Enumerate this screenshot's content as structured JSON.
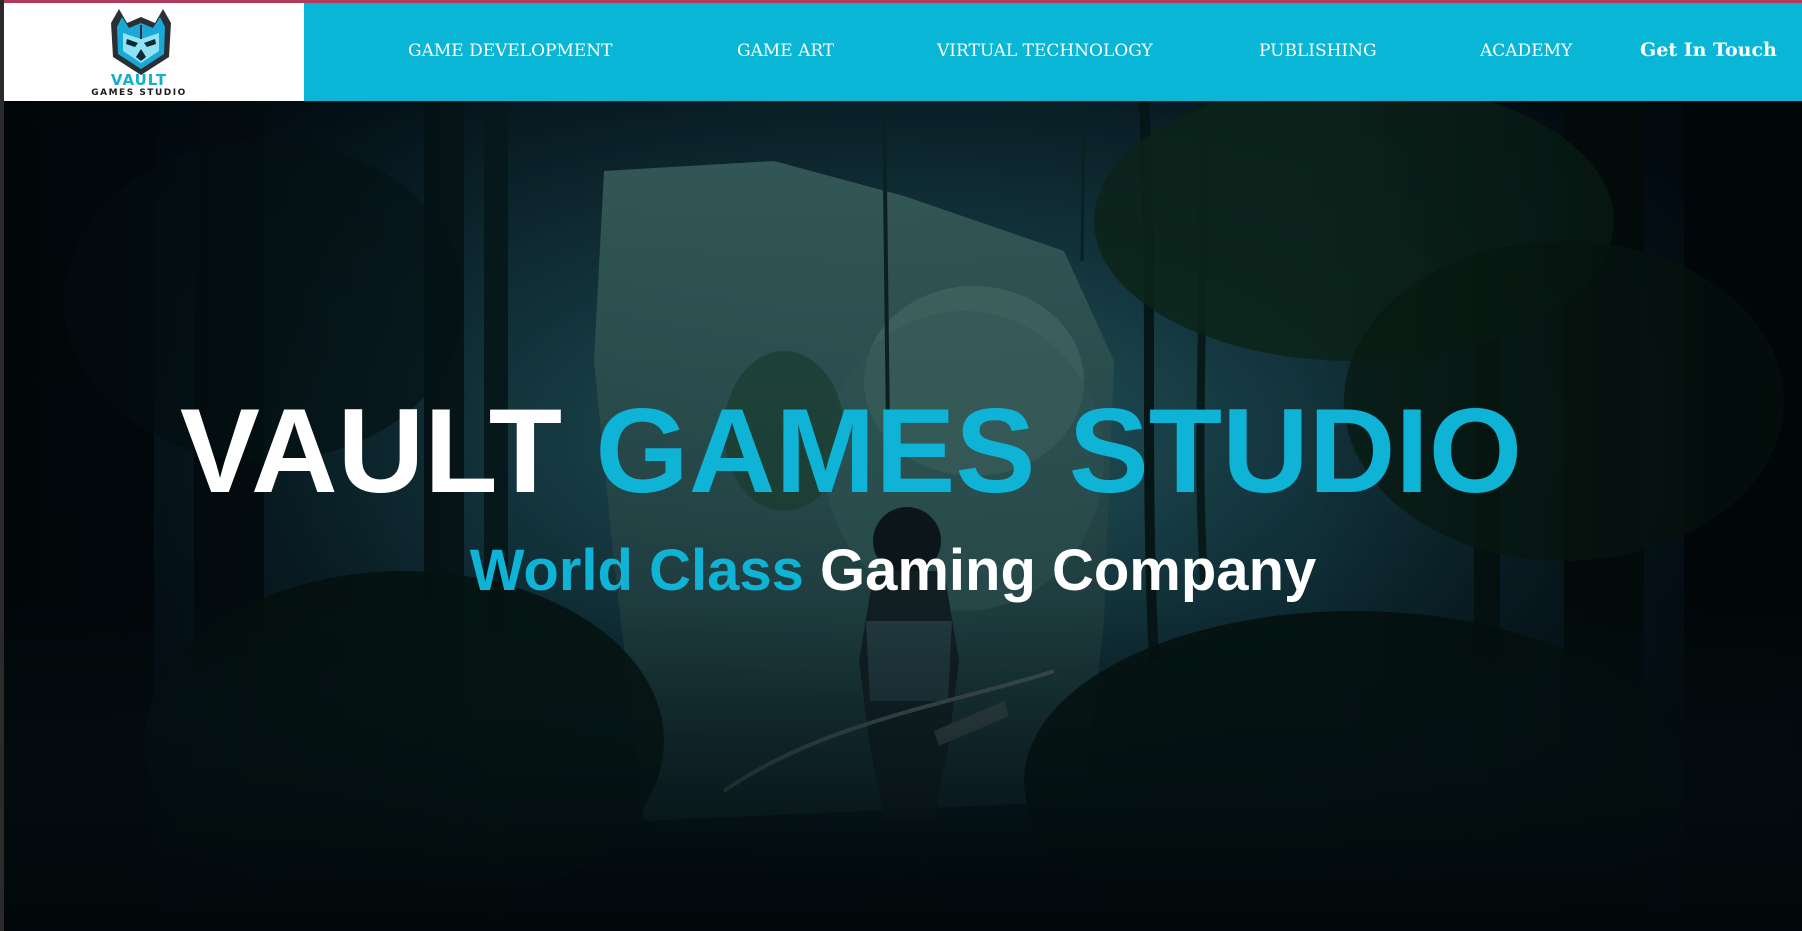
{
  "brand": {
    "name": "VAULT",
    "tagline": "GAMES STUDIO",
    "logo_icon": "wolf-helmet-icon",
    "colors": {
      "accent": "#09b6d5",
      "header_background": "#09b6d5",
      "logo_background": "#ffffff"
    }
  },
  "nav": {
    "items": [
      {
        "label": "GAME DEVELOPMENT"
      },
      {
        "label": "GAME ART"
      },
      {
        "label": "VIRTUAL TECHNOLOGY"
      },
      {
        "label": "PUBLISHING"
      },
      {
        "label": "ACADEMY"
      }
    ],
    "cta_label": "Get In Touch"
  },
  "hero": {
    "title_white": "VAULT",
    "title_accent": "GAMES STUDIO",
    "subtitle_accent": "World Class",
    "subtitle_white": "Gaming Company",
    "background": "dark-jungle-archer-scene"
  }
}
